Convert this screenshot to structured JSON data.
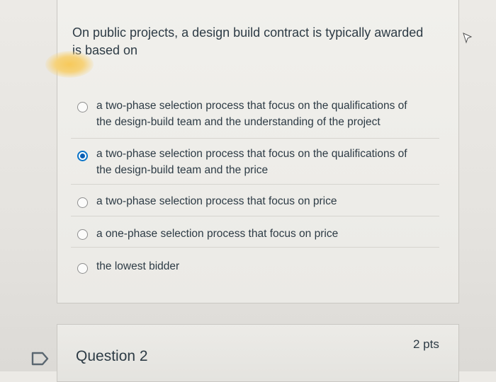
{
  "question": {
    "text_line1": "On public projects, a design build contract is typically awarded",
    "text_line2": "is based on"
  },
  "options": [
    {
      "line1": "a two-phase selection process that focus on the qualifications of",
      "line2": "the design-build team and the understanding of the project",
      "selected": false
    },
    {
      "line1": "a two-phase selection process that focus on the qualifications of",
      "line2": "the design-build team and the price",
      "selected": true
    },
    {
      "line1": "a two-phase selection process that focus on price",
      "line2": "",
      "selected": false
    },
    {
      "line1": "a one-phase selection process that focus on price",
      "line2": "",
      "selected": false
    },
    {
      "line1": "the lowest bidder",
      "line2": "",
      "selected": false
    }
  ],
  "next_question": {
    "title": "Question 2",
    "points": "2 pts"
  },
  "colors": {
    "radio_selected": "#0a5fb4",
    "text": "#2d3b45"
  },
  "icons": {
    "flag": "flag-icon",
    "cursor": "mouse-cursor-icon"
  }
}
